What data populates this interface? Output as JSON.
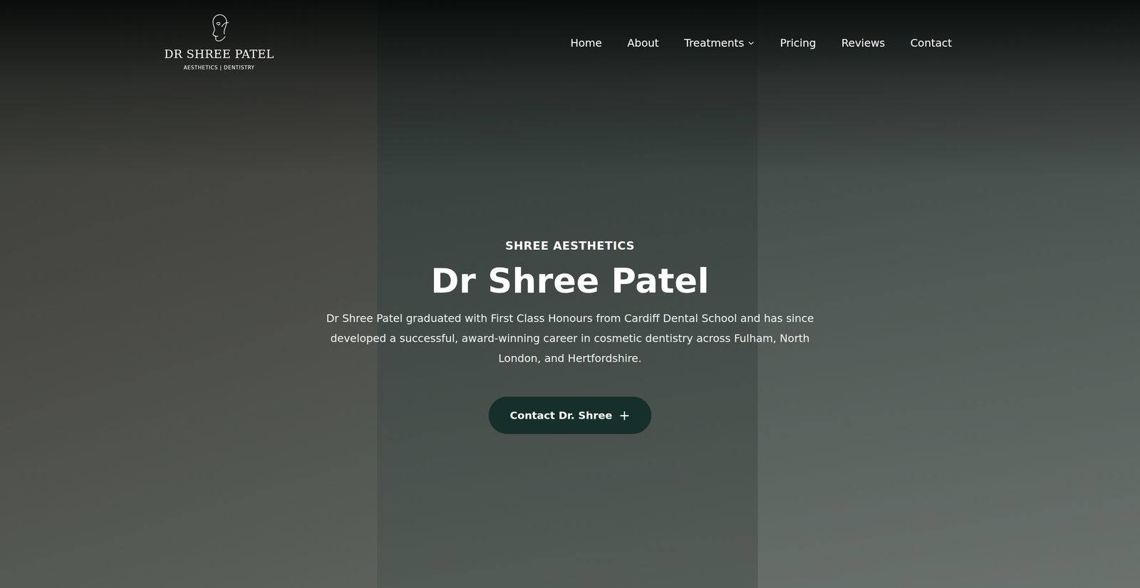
{
  "logo": {
    "name": "DR SHREE PATEL",
    "tagline": "AESTHETICS | DENTISTRY"
  },
  "nav": [
    {
      "label": "Home",
      "kind": "link",
      "expanded": false
    },
    {
      "label": "About",
      "kind": "link",
      "expanded": false
    },
    {
      "label": "Treatments",
      "kind": "dropdown",
      "expanded": false
    },
    {
      "label": "Pricing",
      "kind": "link",
      "expanded": false
    },
    {
      "label": "Reviews",
      "kind": "link",
      "expanded": false
    },
    {
      "label": "Contact",
      "kind": "link",
      "expanded": false
    }
  ],
  "hero": {
    "eyebrow": "SHREE AESTHETICS",
    "title": "Dr Shree Patel",
    "text": "Dr Shree Patel graduated with First Class Honours from Cardiff Dental School and has since developed a successful, award-winning career in cosmetic dentistry across Fulham, North London, and Hertfordshire.",
    "button": {
      "label": "Contact Dr. Shree",
      "icon": "+"
    }
  }
}
